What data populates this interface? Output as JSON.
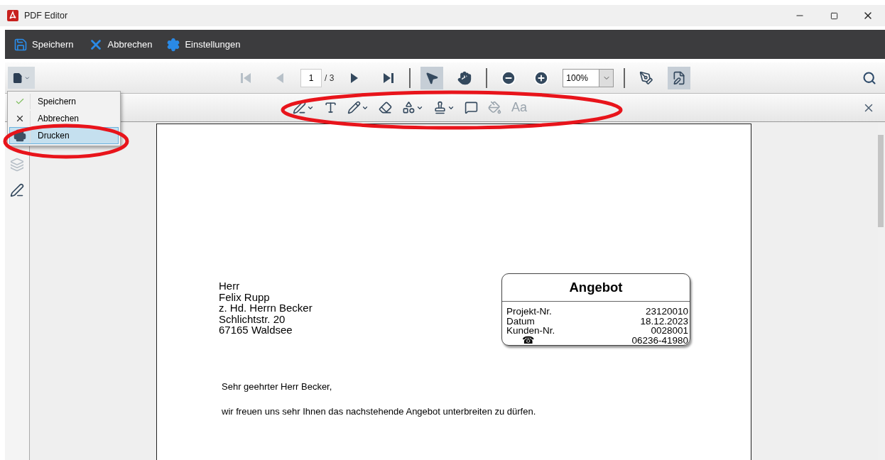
{
  "window": {
    "title": "PDF Editor"
  },
  "main_toolbar": [
    {
      "kind": "save",
      "label": "Speichern"
    },
    {
      "kind": "cancel",
      "label": "Abbrechen"
    },
    {
      "kind": "settings",
      "label": "Einstellungen"
    }
  ],
  "nav_toolbar": [
    {
      "kind": "first",
      "disabled": true
    },
    {
      "kind": "prev",
      "disabled": true
    },
    {
      "kind": "page",
      "value": "1",
      "total": "/ 3"
    },
    {
      "kind": "next",
      "disabled": false
    },
    {
      "kind": "last",
      "disabled": false
    },
    {
      "kind": "separator"
    },
    {
      "kind": "select",
      "selected": true
    },
    {
      "kind": "hand",
      "selected": false
    },
    {
      "kind": "separator"
    },
    {
      "kind": "zoom-out",
      "disabled": false
    },
    {
      "kind": "zoom-in",
      "disabled": false
    },
    {
      "kind": "zoom",
      "value": "100%"
    },
    {
      "kind": "separator"
    },
    {
      "kind": "sign",
      "selected": false
    },
    {
      "kind": "edit",
      "selected": true
    }
  ],
  "annotation_toolbar": [
    {
      "kind": "ink",
      "dropdown": true,
      "disabled": false
    },
    {
      "kind": "text",
      "dropdown": false,
      "disabled": false
    },
    {
      "kind": "pencil",
      "dropdown": true,
      "disabled": false
    },
    {
      "kind": "eraser",
      "dropdown": false,
      "disabled": false
    },
    {
      "kind": "shapes",
      "dropdown": true,
      "disabled": false
    },
    {
      "kind": "stamp",
      "dropdown": true,
      "disabled": false
    },
    {
      "kind": "comment",
      "dropdown": false,
      "disabled": false
    },
    {
      "kind": "fill",
      "dropdown": false,
      "disabled": true
    },
    {
      "kind": "font",
      "label": "Aa",
      "dropdown": false,
      "disabled": true
    }
  ],
  "file_menu": [
    {
      "kind": "check",
      "label": "Speichern",
      "selected": false
    },
    {
      "kind": "cross",
      "label": "Abbrechen",
      "selected": false
    },
    {
      "kind": "print",
      "label": "Drucken",
      "selected": true
    }
  ],
  "sidebar": [
    {
      "kind": "layers",
      "disabled": true
    },
    {
      "kind": "signature",
      "disabled": false
    }
  ],
  "document": {
    "address": [
      "Herr",
      "Felix Rupp",
      "z. Hd. Herrn Becker",
      "Schlichtstr. 20",
      "67165 Waldsee"
    ],
    "info_box": {
      "title": "Angebot",
      "rows": [
        {
          "label": "Projekt-Nr.",
          "value": "23120010",
          "kind": "text"
        },
        {
          "label": "Datum",
          "value": "18.12.2023",
          "kind": "text"
        },
        {
          "label": "Kunden-Nr.",
          "value": "0028001",
          "kind": "text"
        },
        {
          "label": "☎",
          "value": "06236-41980",
          "kind": "phone"
        }
      ]
    },
    "paragraphs": [
      "Sehr geehrter Herr Becker,",
      "wir freuen uns sehr Ihnen das nachstehende Angebot unterbreiten zu dürfen."
    ]
  },
  "highlights": {
    "file_menu": true,
    "annotation_toolbar": true
  }
}
